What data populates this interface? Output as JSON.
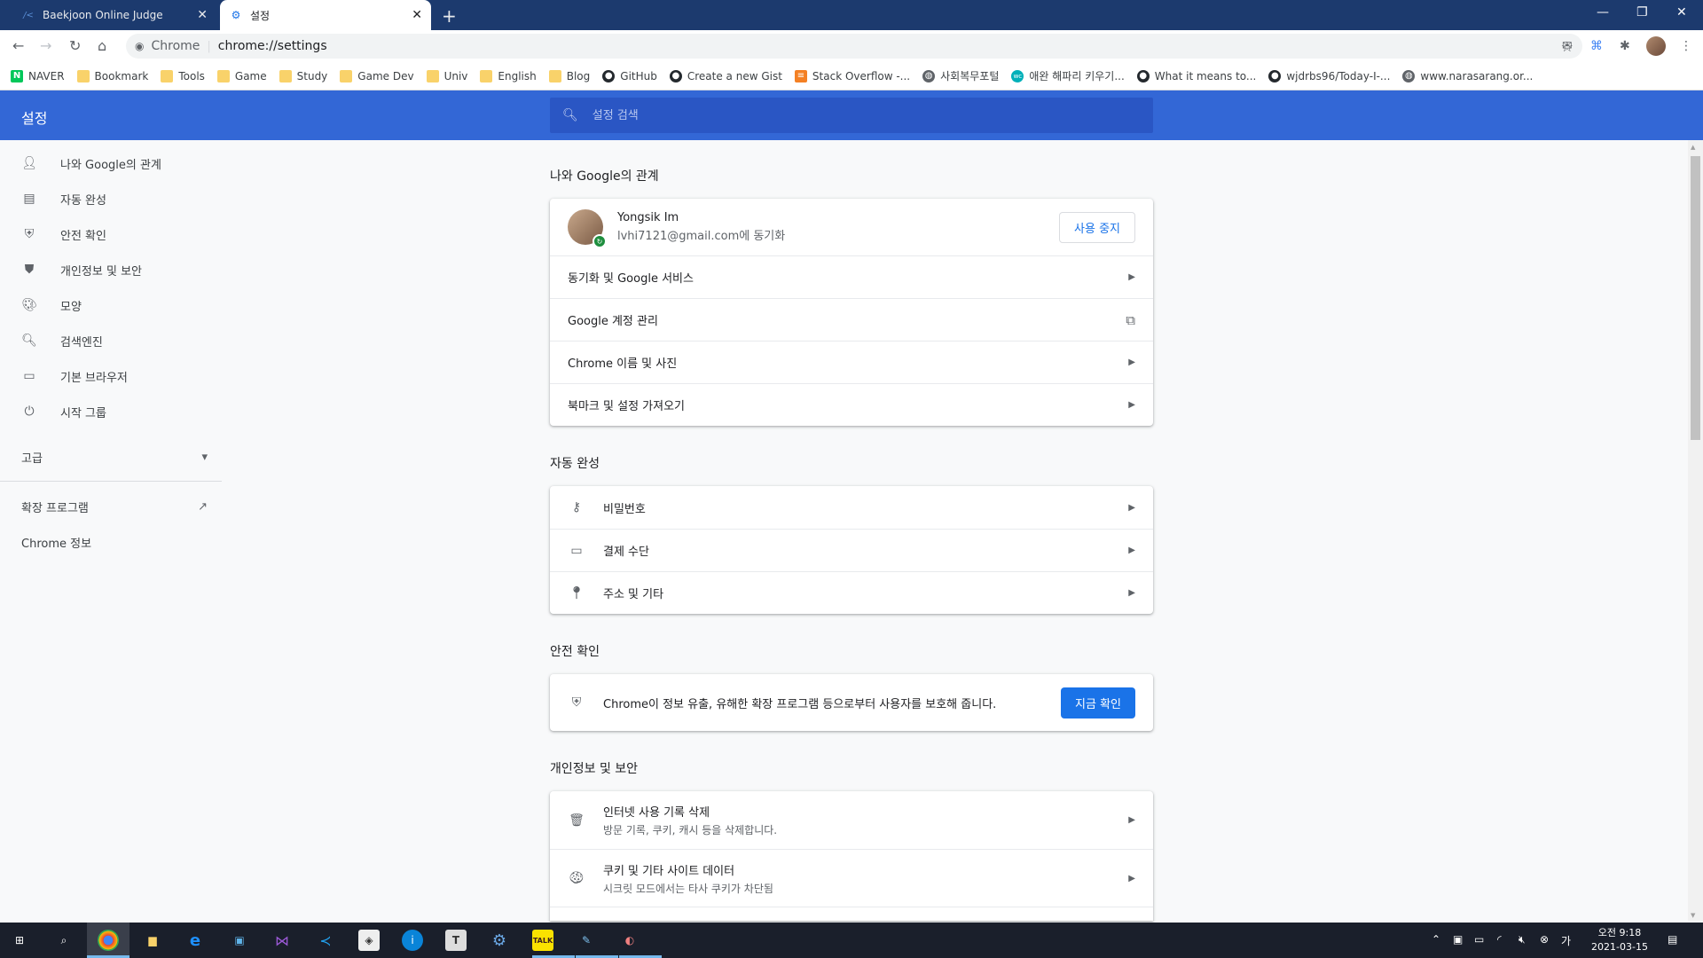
{
  "tabs": [
    {
      "label": "Baekjoon Online Judge",
      "icon": "boj-icon"
    },
    {
      "label": "설정",
      "icon": "gear-icon"
    }
  ],
  "toolbar": {
    "omnibox_label": "Chrome",
    "url": "chrome://settings"
  },
  "bookmarks": [
    {
      "label": "NAVER",
      "icon": "naver"
    },
    {
      "label": "Bookmark",
      "icon": "folder"
    },
    {
      "label": "Tools",
      "icon": "folder"
    },
    {
      "label": "Game",
      "icon": "folder"
    },
    {
      "label": "Study",
      "icon": "folder"
    },
    {
      "label": "Game Dev",
      "icon": "folder"
    },
    {
      "label": "Univ",
      "icon": "folder"
    },
    {
      "label": "English",
      "icon": "folder"
    },
    {
      "label": "Blog",
      "icon": "folder"
    },
    {
      "label": "GitHub",
      "icon": "github"
    },
    {
      "label": "Create a new Gist",
      "icon": "github"
    },
    {
      "label": "Stack Overflow -...",
      "icon": "stackoverflow"
    },
    {
      "label": "사회복무포털",
      "icon": "globe"
    },
    {
      "label": "애완 해파리 키우기...",
      "icon": "wc"
    },
    {
      "label": "What it means to...",
      "icon": "github"
    },
    {
      "label": "wjdrbs96/Today-I-...",
      "icon": "github"
    },
    {
      "label": "www.narasarang.or...",
      "icon": "globe"
    }
  ],
  "header": {
    "title": "설정",
    "search_placeholder": "설정 검색"
  },
  "sidebar": {
    "items": [
      {
        "label": "나와 Google의 관계",
        "icon": "person-icon"
      },
      {
        "label": "자동 완성",
        "icon": "clipboard-icon"
      },
      {
        "label": "안전 확인",
        "icon": "shield-check-icon"
      },
      {
        "label": "개인정보 및 보안",
        "icon": "shield-icon"
      },
      {
        "label": "모양",
        "icon": "palette-icon"
      },
      {
        "label": "검색엔진",
        "icon": "search-icon"
      },
      {
        "label": "기본 브라우저",
        "icon": "browser-icon"
      },
      {
        "label": "시작 그룹",
        "icon": "power-icon"
      }
    ],
    "advanced": "고급",
    "extensions": "확장 프로그램",
    "about": "Chrome 정보"
  },
  "sections": {
    "you_google": {
      "title": "나와 Google의 관계",
      "profile_name": "Yongsik Im",
      "profile_email": "lvhi7121@gmail.com에 동기화",
      "stop_button": "사용 중지",
      "rows": [
        "동기화 및 Google 서비스",
        "Google 계정 관리",
        "Chrome 이름 및 사진",
        "북마크 및 설정 가져오기"
      ]
    },
    "autofill": {
      "title": "자동 완성",
      "rows": [
        {
          "label": "비밀번호",
          "icon": "key-icon"
        },
        {
          "label": "결제 수단",
          "icon": "credit-card-icon"
        },
        {
          "label": "주소 및 기타",
          "icon": "location-pin-icon"
        }
      ]
    },
    "safety": {
      "title": "안전 확인",
      "text": "Chrome이 정보 유출, 유해한 확장 프로그램 등으로부터 사용자를 보호해 줍니다.",
      "button": "지금 확인"
    },
    "privacy": {
      "title": "개인정보 및 보안",
      "rows": [
        {
          "label": "인터넷 사용 기록 삭제",
          "sub": "방문 기록, 쿠키, 캐시 등을 삭제합니다.",
          "icon": "trash-icon"
        },
        {
          "label": "쿠키 및 기타 사이트 데이터",
          "sub": "시크릿 모드에서는 타사 쿠키가 차단됨",
          "icon": "cookie-icon"
        }
      ]
    }
  },
  "taskbar": {
    "time": "오전 9:18",
    "date": "2021-03-15"
  },
  "colors": {
    "header_blue": "#3367d6",
    "accent": "#1a73e8",
    "titlebar": "#1c3a6e"
  }
}
